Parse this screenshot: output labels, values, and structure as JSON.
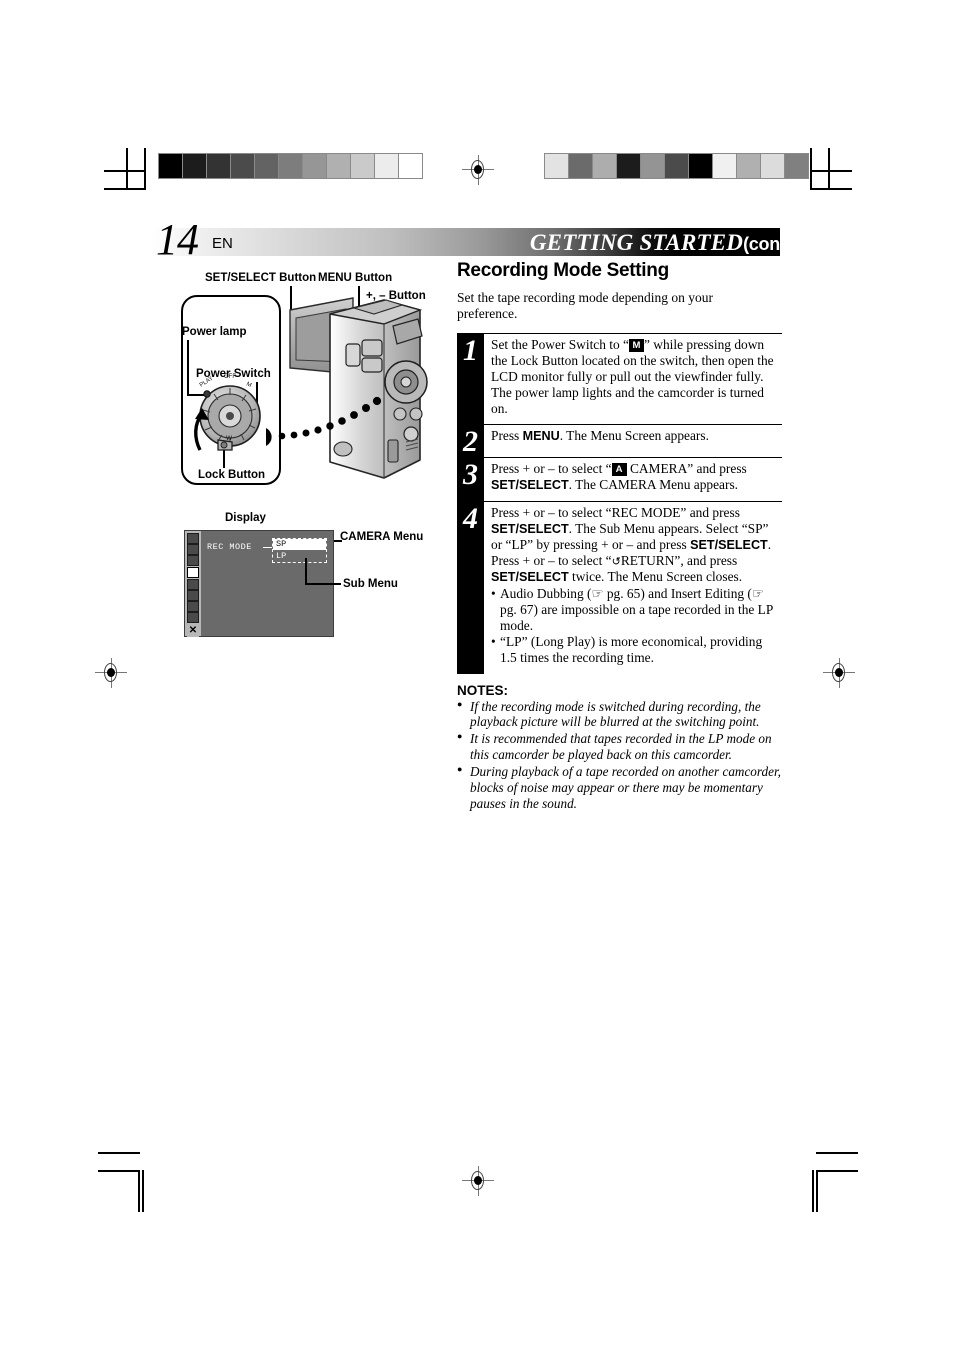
{
  "page": {
    "number": "14",
    "language": "EN",
    "header_title": "GETTING STARTED",
    "header_title_cont": "(cont.)"
  },
  "illustration": {
    "caption_display": "Display",
    "labels": {
      "set_select": "SET/SELECT Button",
      "menu": "MENU Button",
      "plus_minus": "+, – Button",
      "power_lamp": "Power lamp",
      "power_switch": "Power Switch",
      "lock_button": "Lock Button"
    }
  },
  "osd": {
    "rec_mode_label": "REC  MODE",
    "option_sp": "SP",
    "option_lp": "LP",
    "camera_menu_label": "CAMERA Menu",
    "sub_menu_label": "Sub Menu",
    "icon_names": [
      "camera-record-icon",
      "camera-manual-icon",
      "camera-system-icon",
      "camera-auto-icon",
      "display-icon",
      "dsc-icon",
      "clock-icon",
      "still-picture-icon",
      "close-menu-icon"
    ]
  },
  "section": {
    "title": "Recording Mode Setting",
    "intro": "Set the tape recording mode depending on your preference."
  },
  "steps": [
    {
      "number": "1",
      "text_parts": [
        {
          "t": "Set the Power Switch to “"
        },
        {
          "chip": "M"
        },
        {
          "t": "” while pressing down the Lock Button located on the switch, then open the LCD monitor fully or pull out the viewfinder fully. The power lamp lights and the camcorder is turned on."
        }
      ]
    },
    {
      "number": "2",
      "text_parts": [
        {
          "t": "Press "
        },
        {
          "b": "MENU"
        },
        {
          "t": ". The Menu Screen appears."
        }
      ]
    },
    {
      "number": "3",
      "text_parts": [
        {
          "t": "Press + or – to select “"
        },
        {
          "chip": "A"
        },
        {
          "t": " CAMERA” and press "
        },
        {
          "b": "SET/SELECT"
        },
        {
          "t": ". The CAMERA Menu appears."
        }
      ]
    },
    {
      "number": "4",
      "text_parts": [
        {
          "t": "Press + or – to select “REC MODE” and press "
        },
        {
          "b": "SET/SELECT"
        },
        {
          "t": ". The Sub Menu appears. Select “SP” or “LP” by pressing + or – and press "
        },
        {
          "b": "SET/SELECT"
        },
        {
          "t": ". Press + or – to select “"
        },
        {
          "glyph": "↺"
        },
        {
          "t": "RETURN”, and press "
        },
        {
          "b": "SET/SELECT"
        },
        {
          "t": " twice. The Menu Screen closes."
        }
      ],
      "bullets": [
        "Audio Dubbing (☞ pg. 65) and Insert Editing (☞ pg. 67) are impossible on a tape recorded in the LP mode.",
        "“LP” (Long Play) is more economical, providing 1.5 times the recording time."
      ]
    }
  ],
  "notes": {
    "title": "NOTES:",
    "items": [
      "If the recording mode is switched during recording, the playback picture will be blurred at the switching point.",
      "It is recommended that tapes recorded in the LP mode on this camcorder be played back on this camcorder.",
      "During playback of a tape recorded on another camcorder, blocks of noise may appear or there may be momentary pauses in the sound."
    ]
  },
  "calibration": {
    "left_bar": [
      "#000000",
      "#1c1c1c",
      "#333333",
      "#4b4b4b",
      "#636363",
      "#7d7d7d",
      "#969696",
      "#b0b0b0",
      "#cacaca",
      "#ececec",
      "#ffffff"
    ],
    "right_bar": [
      "#e3e3e3",
      "#6b6b6b",
      "#adadad",
      "#1c1c1c",
      "#949494",
      "#4b4b4b",
      "#000000",
      "#f0f0f0",
      "#b0b0b0",
      "#dcdcdc",
      "#808080"
    ]
  }
}
